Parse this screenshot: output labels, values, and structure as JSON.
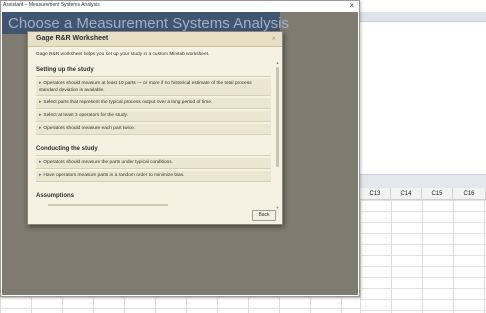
{
  "window": {
    "title": "Assistant – Measurement Systems Analysis",
    "close_glyph": "×"
  },
  "assistant": {
    "heading": "Choose a Measurement Systems Analysis"
  },
  "dialog": {
    "title": "Gage R&R Worksheet",
    "close_glyph": "×",
    "intro": "Gage R&R worksheet helps you set up your study in a custom Minitab worksheet.",
    "sections": [
      {
        "title": "Setting up the study",
        "bullets": [
          "Operators should measure at least 10 parts — or more if no historical estimate of the total process standard deviation is available.",
          "Select parts that represent the typical process output over a long period of time.",
          "Select at least 3 operators for the study.",
          "Operators should measure each part twice."
        ]
      },
      {
        "title": "Conducting the study",
        "bullets": [
          "Operators should measure the parts under typical conditions.",
          "Have operators measure parts in a random order to minimize bias."
        ]
      },
      {
        "title": "Assumptions",
        "bullets": []
      }
    ],
    "back_label": "Back"
  },
  "worksheet": {
    "columns": [
      "C13",
      "C14",
      "C15",
      "C16"
    ]
  },
  "colors": {
    "heading_band": "#405570",
    "assistant_background": "#7f7b71",
    "dialog_background": "#f6f2e3",
    "dialog_title_bar": "#e7e0c6",
    "bullet_row": "#ece6d1"
  },
  "icons": {
    "window_close": "close-icon",
    "dialog_close": "close-icon",
    "bullet": "triangle-bullet-icon",
    "scroll_up": "chevron-up-icon",
    "scroll_down": "chevron-down-icon"
  }
}
